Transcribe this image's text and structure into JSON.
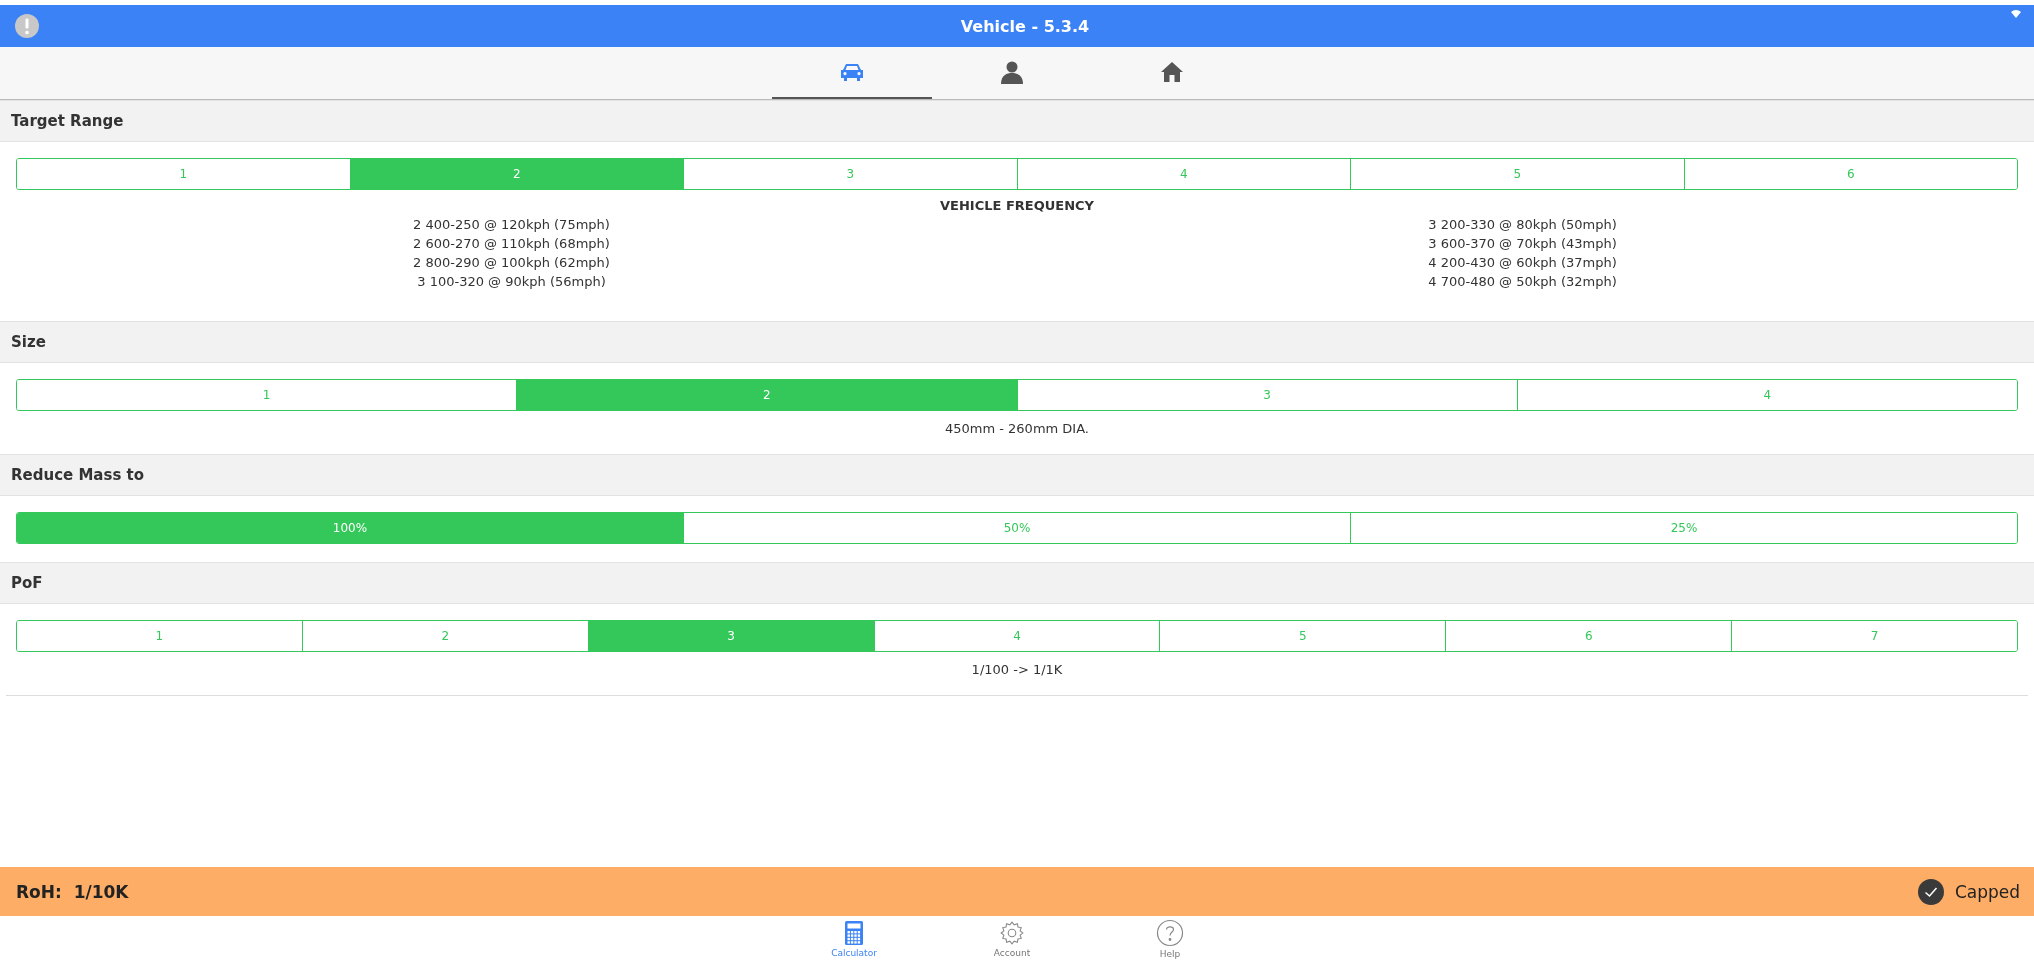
{
  "window": {
    "title": "Vehicle - 5.3.4"
  },
  "tabs": [
    {
      "kind": "car",
      "selected": true
    },
    {
      "kind": "person",
      "selected": false
    },
    {
      "kind": "home",
      "selected": false
    }
  ],
  "sections": [
    {
      "title": "Target Range",
      "options": [
        {
          "label": "1",
          "selected": false
        },
        {
          "label": "2",
          "selected": true
        },
        {
          "label": "3",
          "selected": false
        },
        {
          "label": "4",
          "selected": false
        },
        {
          "label": "5",
          "selected": false
        },
        {
          "label": "6",
          "selected": false
        }
      ],
      "info": {
        "kind": "frequency",
        "heading": "VEHICLE FREQUENCY",
        "left": [
          "2 400-250 @ 120kph (75mph)",
          "2 600-270 @ 110kph (68mph)",
          "2 800-290 @ 100kph (62mph)",
          "3 100-320 @ 90kph (56mph)"
        ],
        "right": [
          "3 200-330 @ 80kph (50mph)",
          "3 600-370 @ 70kph (43mph)",
          "4 200-430 @ 60kph (37mph)",
          "4 700-480 @ 50kph (32mph)"
        ]
      }
    },
    {
      "title": "Size",
      "options": [
        {
          "label": "1",
          "selected": false
        },
        {
          "label": "2",
          "selected": true
        },
        {
          "label": "3",
          "selected": false
        },
        {
          "label": "4",
          "selected": false
        }
      ],
      "info": {
        "kind": "text",
        "text": "450mm - 260mm DIA."
      }
    },
    {
      "title": "Reduce Mass to",
      "options": [
        {
          "label": "100%",
          "selected": true
        },
        {
          "label": "50%",
          "selected": false
        },
        {
          "label": "25%",
          "selected": false
        }
      ]
    },
    {
      "title": "PoF",
      "options": [
        {
          "label": "1",
          "selected": false
        },
        {
          "label": "2",
          "selected": false
        },
        {
          "label": "3",
          "selected": true
        },
        {
          "label": "4",
          "selected": false
        },
        {
          "label": "5",
          "selected": false
        },
        {
          "label": "6",
          "selected": false
        },
        {
          "label": "7",
          "selected": false
        }
      ],
      "info": {
        "kind": "text",
        "text": "1/100 -> 1/1K"
      }
    }
  ],
  "result": {
    "label": "RoH:",
    "value": "1/10K",
    "status": "Capped"
  },
  "bottom_nav": [
    {
      "kind": "calculator",
      "label": "Calculator",
      "selected": true
    },
    {
      "kind": "gear",
      "label": "Account",
      "selected": false
    },
    {
      "kind": "help",
      "label": "Help",
      "selected": false
    }
  ]
}
